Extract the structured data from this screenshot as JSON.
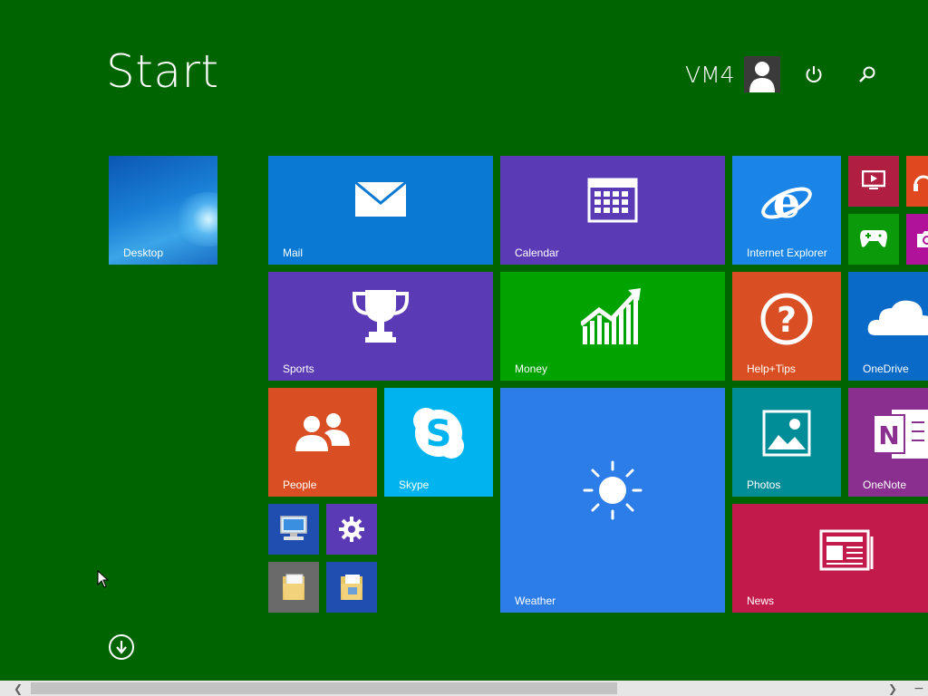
{
  "screen": {
    "title": "Start"
  },
  "user": {
    "name": "VM4"
  },
  "header_icons": [
    "user-avatar-icon",
    "power-icon",
    "search-icon"
  ],
  "tiles": {
    "desktop": "Desktop",
    "mail": "Mail",
    "calendar": "Calendar",
    "internet_explorer": "Internet Explorer",
    "sports": "Sports",
    "money": "Money",
    "help_tips": "Help+Tips",
    "onedrive": "OneDrive",
    "people": "People",
    "skype": "Skype",
    "weather": "Weather",
    "photos": "Photos",
    "onenote": "OneNote",
    "news": "News"
  },
  "small_tile_icons": [
    "video-icon",
    "music-icon",
    "games-icon",
    "camera-icon",
    "computer-icon",
    "settings-icon",
    "file-explorer-icon",
    "documents-folder-icon"
  ],
  "colors": {
    "background": "#006400",
    "blue": "#0a79d4",
    "purple": "#5b3bb5",
    "green": "#00a300",
    "orange": "#d94f23",
    "teal": "#008d97",
    "red": "#b01e42",
    "crimson": "#c21a4b"
  }
}
